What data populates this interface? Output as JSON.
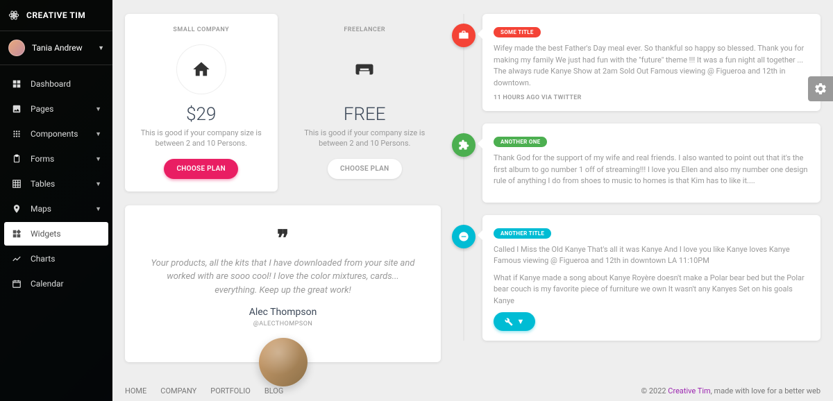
{
  "brand": "CREATIVE TIM",
  "user": {
    "name": "Tania Andrew"
  },
  "nav": [
    {
      "label": "Dashboard",
      "icon": "dashboard"
    },
    {
      "label": "Pages",
      "icon": "image",
      "expandable": true
    },
    {
      "label": "Components",
      "icon": "apps",
      "expandable": true
    },
    {
      "label": "Forms",
      "icon": "clipboard",
      "expandable": true
    },
    {
      "label": "Tables",
      "icon": "grid",
      "expandable": true
    },
    {
      "label": "Maps",
      "icon": "place",
      "expandable": true
    },
    {
      "label": "Widgets",
      "icon": "widgets",
      "active": true
    },
    {
      "label": "Charts",
      "icon": "timeline"
    },
    {
      "label": "Calendar",
      "icon": "calendar"
    }
  ],
  "pricing": [
    {
      "category": "SMALL COMPANY",
      "price": "$29",
      "desc": "This is good if your company size is between 2 and 10 Persons.",
      "button": "CHOOSE PLAN",
      "style": "raised"
    },
    {
      "category": "FREELANCER",
      "price": "FREE",
      "desc": "This is good if your company size is between 2 and 10 Persons.",
      "button": "CHOOSE PLAN",
      "style": "plain"
    }
  ],
  "testimonial": {
    "text": "Your products, all the kits that I have downloaded from your site and worked with are sooo cool! I love the color mixtures, cards... everything. Keep up the great work!",
    "author": "Alec Thompson",
    "handle": "@ALECTHOMPSON"
  },
  "timeline": [
    {
      "badge": "red",
      "pill": "SOME TITLE",
      "text": "Wifey made the best Father's Day meal ever. So thankful so happy so blessed. Thank you for making my family We just had fun with the \"future\" theme !!! It was a fun night all together ... The always rude Kanye Show at 2am Sold Out Famous viewing @ Figueroa and 12th in downtown.",
      "meta": "11 HOURS AGO VIA TWITTER"
    },
    {
      "badge": "green",
      "pill": "ANOTHER ONE",
      "text": "Thank God for the support of my wife and real friends. I also wanted to point out that it's the first album to go number 1 off of streaming!!! I love you Ellen and also my number one design rule of anything I do from shoes to music to homes is that Kim has to like it...."
    },
    {
      "badge": "blue",
      "pill": "ANOTHER TITLE",
      "text": "Called I Miss the Old Kanye That's all it was Kanye And I love you like Kanye loves Kanye Famous viewing @ Figueroa and 12th in downtown LA 11:10PM",
      "text2": "What if Kanye made a song about Kanye Royère doesn't make a Polar bear bed but the Polar bear couch is my favorite piece of furniture we own It wasn't any Kanyes Set on his goals Kanye",
      "hasButton": true
    }
  ],
  "footer": {
    "links": [
      "HOME",
      "COMPANY",
      "PORTFOLIO",
      "BLOG"
    ],
    "copyright_prefix": "© 2022 ",
    "copyright_link": "Creative Tim",
    "copyright_suffix": ", made with love for a better web"
  }
}
